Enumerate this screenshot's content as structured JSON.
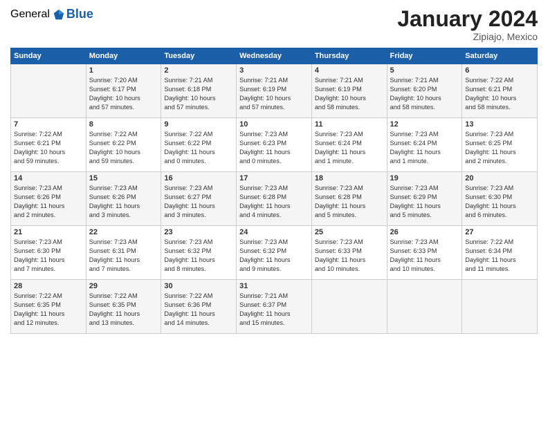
{
  "logo": {
    "general": "General",
    "blue": "Blue"
  },
  "title": "January 2024",
  "subtitle": "Zipiajo, Mexico",
  "header": {
    "days": [
      "Sunday",
      "Monday",
      "Tuesday",
      "Wednesday",
      "Thursday",
      "Friday",
      "Saturday"
    ]
  },
  "weeks": [
    [
      {
        "day": "",
        "info": ""
      },
      {
        "day": "1",
        "info": "Sunrise: 7:20 AM\nSunset: 6:17 PM\nDaylight: 10 hours\nand 57 minutes."
      },
      {
        "day": "2",
        "info": "Sunrise: 7:21 AM\nSunset: 6:18 PM\nDaylight: 10 hours\nand 57 minutes."
      },
      {
        "day": "3",
        "info": "Sunrise: 7:21 AM\nSunset: 6:19 PM\nDaylight: 10 hours\nand 57 minutes."
      },
      {
        "day": "4",
        "info": "Sunrise: 7:21 AM\nSunset: 6:19 PM\nDaylight: 10 hours\nand 58 minutes."
      },
      {
        "day": "5",
        "info": "Sunrise: 7:21 AM\nSunset: 6:20 PM\nDaylight: 10 hours\nand 58 minutes."
      },
      {
        "day": "6",
        "info": "Sunrise: 7:22 AM\nSunset: 6:21 PM\nDaylight: 10 hours\nand 58 minutes."
      }
    ],
    [
      {
        "day": "7",
        "info": "Sunrise: 7:22 AM\nSunset: 6:21 PM\nDaylight: 10 hours\nand 59 minutes."
      },
      {
        "day": "8",
        "info": "Sunrise: 7:22 AM\nSunset: 6:22 PM\nDaylight: 10 hours\nand 59 minutes."
      },
      {
        "day": "9",
        "info": "Sunrise: 7:22 AM\nSunset: 6:22 PM\nDaylight: 11 hours\nand 0 minutes."
      },
      {
        "day": "10",
        "info": "Sunrise: 7:23 AM\nSunset: 6:23 PM\nDaylight: 11 hours\nand 0 minutes."
      },
      {
        "day": "11",
        "info": "Sunrise: 7:23 AM\nSunset: 6:24 PM\nDaylight: 11 hours\nand 1 minute."
      },
      {
        "day": "12",
        "info": "Sunrise: 7:23 AM\nSunset: 6:24 PM\nDaylight: 11 hours\nand 1 minute."
      },
      {
        "day": "13",
        "info": "Sunrise: 7:23 AM\nSunset: 6:25 PM\nDaylight: 11 hours\nand 2 minutes."
      }
    ],
    [
      {
        "day": "14",
        "info": "Sunrise: 7:23 AM\nSunset: 6:26 PM\nDaylight: 11 hours\nand 2 minutes."
      },
      {
        "day": "15",
        "info": "Sunrise: 7:23 AM\nSunset: 6:26 PM\nDaylight: 11 hours\nand 3 minutes."
      },
      {
        "day": "16",
        "info": "Sunrise: 7:23 AM\nSunset: 6:27 PM\nDaylight: 11 hours\nand 3 minutes."
      },
      {
        "day": "17",
        "info": "Sunrise: 7:23 AM\nSunset: 6:28 PM\nDaylight: 11 hours\nand 4 minutes."
      },
      {
        "day": "18",
        "info": "Sunrise: 7:23 AM\nSunset: 6:28 PM\nDaylight: 11 hours\nand 5 minutes."
      },
      {
        "day": "19",
        "info": "Sunrise: 7:23 AM\nSunset: 6:29 PM\nDaylight: 11 hours\nand 5 minutes."
      },
      {
        "day": "20",
        "info": "Sunrise: 7:23 AM\nSunset: 6:30 PM\nDaylight: 11 hours\nand 6 minutes."
      }
    ],
    [
      {
        "day": "21",
        "info": "Sunrise: 7:23 AM\nSunset: 6:30 PM\nDaylight: 11 hours\nand 7 minutes."
      },
      {
        "day": "22",
        "info": "Sunrise: 7:23 AM\nSunset: 6:31 PM\nDaylight: 11 hours\nand 7 minutes."
      },
      {
        "day": "23",
        "info": "Sunrise: 7:23 AM\nSunset: 6:32 PM\nDaylight: 11 hours\nand 8 minutes."
      },
      {
        "day": "24",
        "info": "Sunrise: 7:23 AM\nSunset: 6:32 PM\nDaylight: 11 hours\nand 9 minutes."
      },
      {
        "day": "25",
        "info": "Sunrise: 7:23 AM\nSunset: 6:33 PM\nDaylight: 11 hours\nand 10 minutes."
      },
      {
        "day": "26",
        "info": "Sunrise: 7:23 AM\nSunset: 6:33 PM\nDaylight: 11 hours\nand 10 minutes."
      },
      {
        "day": "27",
        "info": "Sunrise: 7:22 AM\nSunset: 6:34 PM\nDaylight: 11 hours\nand 11 minutes."
      }
    ],
    [
      {
        "day": "28",
        "info": "Sunrise: 7:22 AM\nSunset: 6:35 PM\nDaylight: 11 hours\nand 12 minutes."
      },
      {
        "day": "29",
        "info": "Sunrise: 7:22 AM\nSunset: 6:35 PM\nDaylight: 11 hours\nand 13 minutes."
      },
      {
        "day": "30",
        "info": "Sunrise: 7:22 AM\nSunset: 6:36 PM\nDaylight: 11 hours\nand 14 minutes."
      },
      {
        "day": "31",
        "info": "Sunrise: 7:21 AM\nSunset: 6:37 PM\nDaylight: 11 hours\nand 15 minutes."
      },
      {
        "day": "",
        "info": ""
      },
      {
        "day": "",
        "info": ""
      },
      {
        "day": "",
        "info": ""
      }
    ]
  ]
}
